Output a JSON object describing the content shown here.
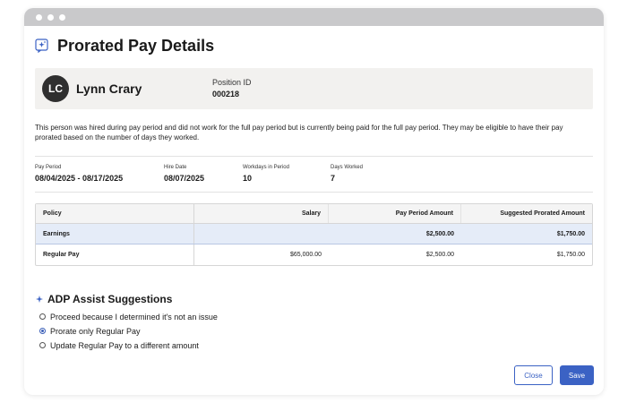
{
  "window": {
    "titlebar_color": "#c9c9cb"
  },
  "header": {
    "title": "Prorated Pay Details",
    "icon": "sparkle-chat-icon"
  },
  "person": {
    "initials": "LC",
    "name": "Lynn Crary",
    "position_label": "Position ID",
    "position_value": "000218"
  },
  "notice": "This person was hired during pay period and did not work for the full pay period but is currently being paid for the full pay period. They may be eligible to have their pay prorated based on the number of days they worked.",
  "info": [
    {
      "label": "Pay Period",
      "value": "08/04/2025 - 08/17/2025"
    },
    {
      "label": "Hire Date",
      "value": "08/07/2025"
    },
    {
      "label": "Workdays in Period",
      "value": "10"
    },
    {
      "label": "Days Worked",
      "value": "7"
    }
  ],
  "table": {
    "columns": [
      "Policy",
      "Salary",
      "Pay Period Amount",
      "Suggested Prorated Amount"
    ],
    "rows": [
      [
        "Earnings",
        "",
        "$2,500.00",
        "$1,750.00"
      ],
      [
        "Regular Pay",
        "$65,000.00",
        "$2,500.00",
        "$1,750.00"
      ]
    ]
  },
  "suggestions": {
    "title": "ADP Assist Suggestions",
    "icon": "sparkle-icon",
    "options": [
      {
        "label": "Proceed because I determined it's not an issue",
        "selected": false
      },
      {
        "label": "Prorate only Regular Pay",
        "selected": true
      },
      {
        "label": "Update Regular Pay to a different amount",
        "selected": false
      }
    ]
  },
  "buttons": {
    "close": "Close",
    "save": "Save"
  },
  "colors": {
    "accent": "#3b62c4",
    "highlight_row": "#e5ecf8",
    "card_bg": "#f2f1ef"
  }
}
